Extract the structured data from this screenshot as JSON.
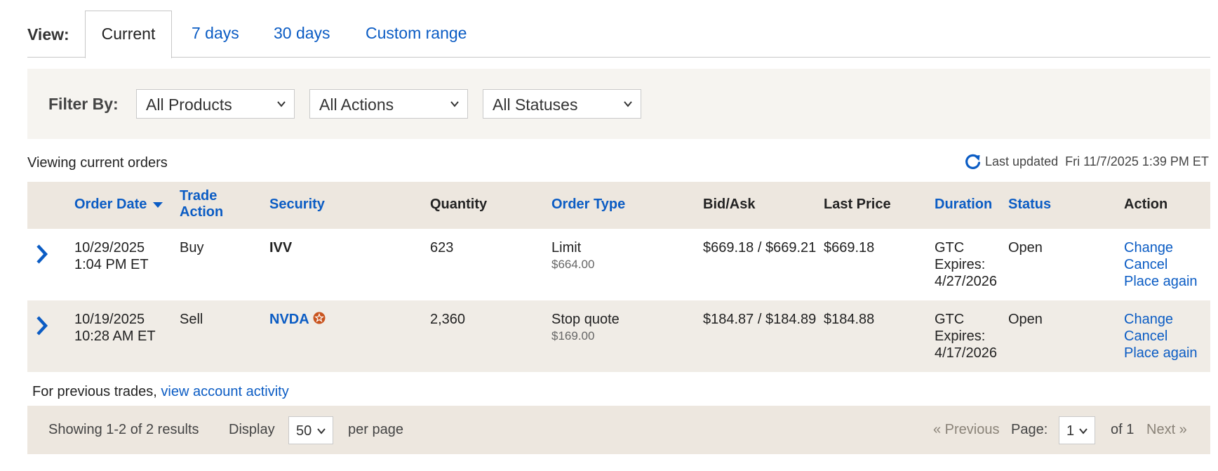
{
  "view": {
    "label": "View:",
    "tabs": [
      "Current",
      "7 days",
      "30 days",
      "Custom range"
    ]
  },
  "filter": {
    "label": "Filter By:",
    "products": "All Products",
    "actions": "All Actions",
    "statuses": "All Statuses"
  },
  "status_line": {
    "viewing": "Viewing current orders",
    "last_updated_label": "Last updated",
    "last_updated_value": "Fri 11/7/2025 1:39 PM ET"
  },
  "table": {
    "headers": {
      "order_date": "Order Date",
      "trade_action_1": "Trade",
      "trade_action_2": "Action",
      "security": "Security",
      "quantity": "Quantity",
      "order_type": "Order Type",
      "bid_ask": "Bid/Ask",
      "last_price": "Last Price",
      "duration": "Duration",
      "status": "Status",
      "action": "Action"
    },
    "rows": [
      {
        "date": "10/29/2025",
        "time": "1:04 PM ET",
        "trade_action": "Buy",
        "security": "IVV",
        "quantity": "623",
        "order_type": "Limit",
        "order_price": "$664.00",
        "bid_ask": "$669.18 / $669.21",
        "last_price": "$669.18",
        "duration": "GTC",
        "expires_label": "Expires:",
        "expires_date": "4/27/2026",
        "status": "Open",
        "actions": [
          "Change",
          "Cancel",
          "Place again"
        ]
      },
      {
        "date": "10/19/2025",
        "time": "10:28 AM ET",
        "trade_action": "Sell",
        "security": "NVDA",
        "quantity": "2,360",
        "order_type": "Stop quote",
        "order_price": "$169.00",
        "bid_ask": "$184.87 / $184.89",
        "last_price": "$184.88",
        "duration": "GTC",
        "expires_label": "Expires:",
        "expires_date": "4/17/2026",
        "status": "Open",
        "actions": [
          "Change",
          "Cancel",
          "Place again"
        ]
      }
    ]
  },
  "previous": {
    "text": "For previous trades,",
    "link": "view account activity"
  },
  "footer": {
    "showing": "Showing 1-2 of 2 results",
    "display_label": "Display",
    "display_value": "50",
    "per_page": "per page",
    "previous": "« Previous",
    "page_label": "Page:",
    "page_value": "1",
    "of_total": "of 1",
    "next": "Next »"
  },
  "colors": {
    "link": "#0b5cc4",
    "header_bg": "#ede7df",
    "filter_bg": "#f6f4f0",
    "star_badge": "#c9541f"
  },
  "icons": {
    "refresh": "refresh-icon",
    "expand": "chevron-right-icon",
    "sort": "sort-desc-icon",
    "dropdown": "chevron-down-icon",
    "badge": "star-badge-icon"
  }
}
